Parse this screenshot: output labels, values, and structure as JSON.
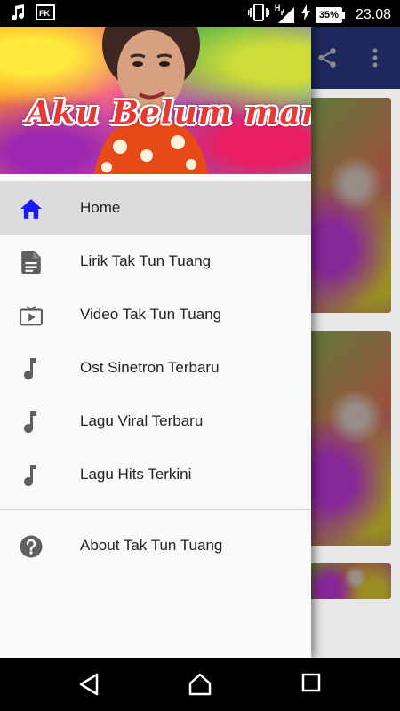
{
  "status_bar": {
    "time": "23.08",
    "battery": "35%",
    "network_label": "H",
    "left_icons": [
      "music-note-icon",
      "fk-notification-icon"
    ],
    "right_icons": [
      "vibrate-icon",
      "signal-icon",
      "charging-icon",
      "battery-icon"
    ]
  },
  "app": {
    "toolbar_color": "#3949ab",
    "toolbar_icons": [
      "share-icon",
      "overflow-menu-icon"
    ]
  },
  "drawer": {
    "header_title": "Aku Belum mandi",
    "items": [
      {
        "label": "Home",
        "icon": "home-icon",
        "active": true
      },
      {
        "label": "Lirik Tak Tun Tuang",
        "icon": "document-icon",
        "active": false
      },
      {
        "label": "Video Tak Tun Tuang",
        "icon": "tv-icon",
        "active": false
      },
      {
        "label": "Ost Sinetron Terbaru",
        "icon": "music-note-icon",
        "active": false
      },
      {
        "label": "Lagu Viral Terbaru",
        "icon": "music-note-icon",
        "active": false
      },
      {
        "label": "Lagu Hits Terkini",
        "icon": "music-note-icon",
        "active": false
      }
    ],
    "secondary_items": [
      {
        "label": "About Tak Tun Tuang",
        "icon": "help-icon"
      }
    ],
    "active_color": "#1a1aff",
    "icon_color": "#5f5f5f"
  },
  "nav_bar": {
    "buttons": [
      "back-icon",
      "home-icon",
      "recents-icon"
    ]
  }
}
